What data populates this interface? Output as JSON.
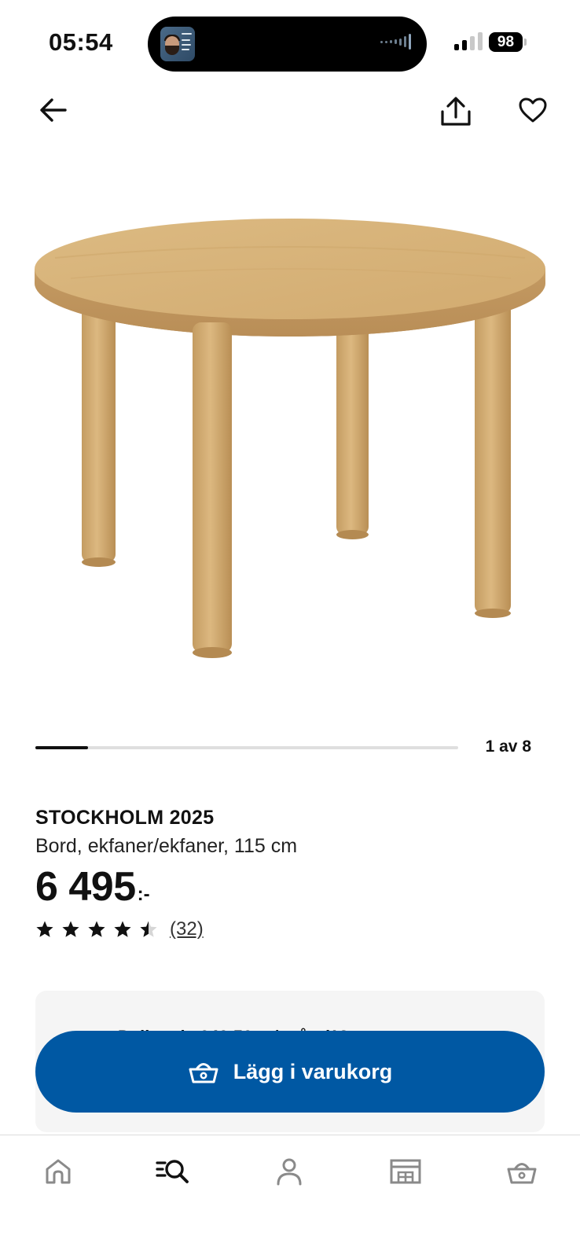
{
  "status_bar": {
    "time": "05:54",
    "battery": "98"
  },
  "top_nav": {
    "back_icon": "arrow-left-icon",
    "share_icon": "share-icon",
    "favorite_icon": "heart-icon"
  },
  "gallery": {
    "counter": "1 av 8",
    "current_index": 1,
    "total": 8,
    "progress_fraction": 0.125
  },
  "product": {
    "name": "STOCKHOLM 2025",
    "description": "Bord, ekfaner/ekfaner, 115 cm",
    "price": "6 495",
    "price_suffix": ":-",
    "rating_value": 4.5,
    "rating_max": 5,
    "review_count": "(32)"
  },
  "info_card": {
    "text": "Delbetala 649,50 :- / mån (12"
  },
  "actions": {
    "add_to_cart_label": "Lägg i varukorg",
    "add_to_cart_icon": "basket-icon"
  },
  "tab_bar": {
    "tabs": [
      {
        "icon": "home-icon",
        "active": false
      },
      {
        "icon": "search-icon",
        "active": true
      },
      {
        "icon": "profile-icon",
        "active": false
      },
      {
        "icon": "store-icon",
        "active": false
      },
      {
        "icon": "basket-icon",
        "active": false
      }
    ]
  },
  "colors": {
    "brand_blue": "#0058a3",
    "text": "#111111",
    "inactive_icon": "#8a8a8a",
    "wood_light": "#d9b57b",
    "wood_dark": "#b88a4f"
  }
}
